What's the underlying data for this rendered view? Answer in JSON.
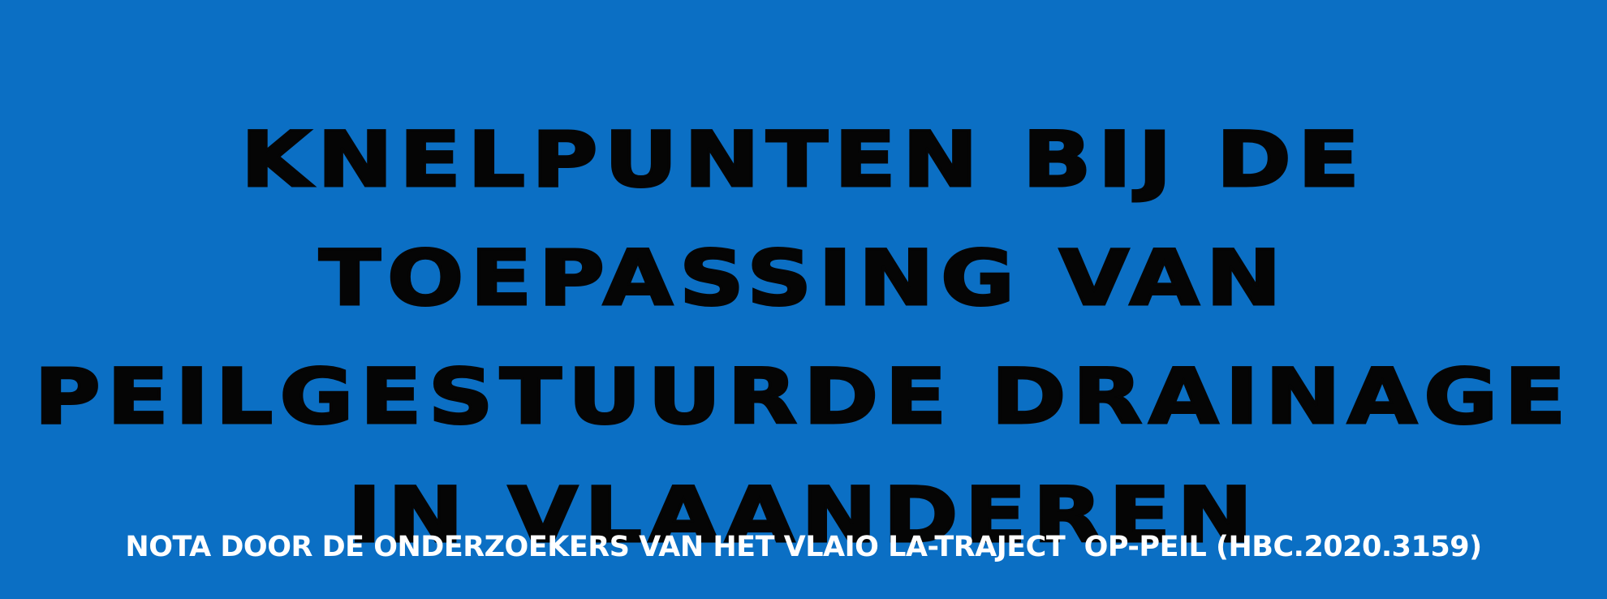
{
  "banner": {
    "background_color": "#0b6fc4",
    "title_color": "#050505",
    "subtitle_color": "#ffffff",
    "title_lines": [
      "KNELPUNTEN BIJ DE",
      "TOEPASSING VAN",
      "PEILGESTUURDE DRAINAGE",
      "IN VLAANDEREN"
    ],
    "subtitle": "NOTA DOOR DE ONDERZOEKERS VAN HET VLAIO LA-TRAJECT  OP-PEIL (HBC.2020.3159)"
  }
}
